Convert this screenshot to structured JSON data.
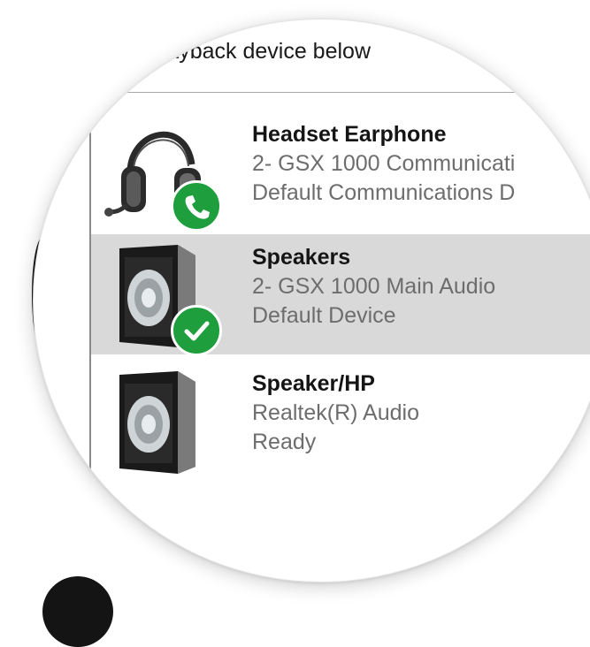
{
  "instruction": "a playback device below",
  "devices": [
    {
      "name": "Headset Earphone",
      "line1": "2- GSX 1000 Communicati",
      "line2": "Default Communications D",
      "icon": "headset-icon",
      "badge": "phone-badge-icon",
      "selected": false
    },
    {
      "name": "Speakers",
      "line1": "2- GSX 1000 Main Audio",
      "line2": "Default Device",
      "icon": "speaker-icon",
      "badge": "checkmark-badge-icon",
      "selected": true
    },
    {
      "name": "Speaker/HP",
      "line1": "Realtek(R) Audio",
      "line2": "Ready",
      "icon": "speaker-icon",
      "badge": null,
      "selected": false
    }
  ],
  "colors": {
    "selected_bg": "#d9d9d9",
    "badge_green": "#1e9e3c",
    "secondary_text": "#6d6d6d"
  }
}
